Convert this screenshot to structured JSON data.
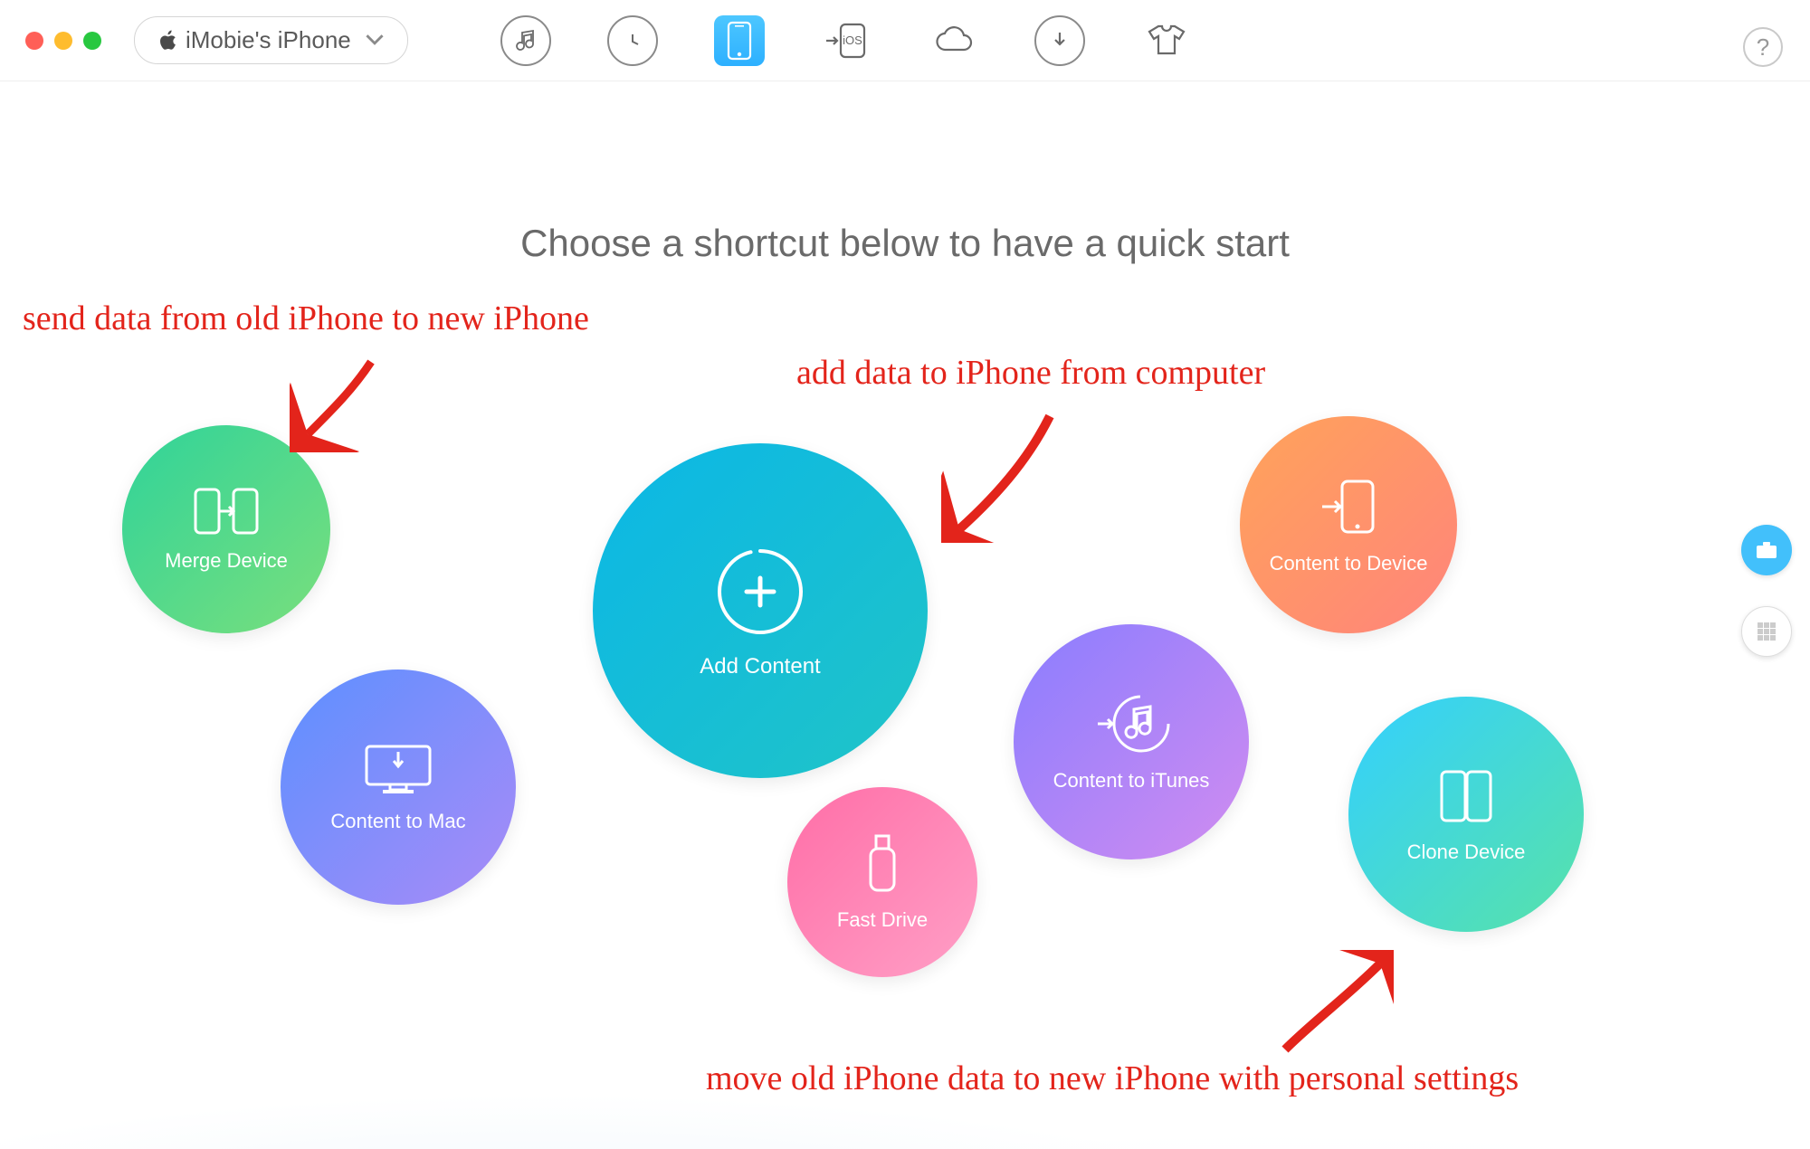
{
  "window": {
    "deviceLabel": "iMobie's iPhone"
  },
  "nav": {
    "items": [
      "music",
      "history",
      "device",
      "to-ios",
      "icloud",
      "download",
      "tshirt"
    ],
    "activeIndex": 2
  },
  "heading": "Choose a shortcut below to have a quick start",
  "bubbles": {
    "merge": {
      "label": "Merge Device"
    },
    "mac": {
      "label": "Content to Mac"
    },
    "add": {
      "label": "Add Content"
    },
    "fast": {
      "label": "Fast Drive"
    },
    "itunes": {
      "label": "Content to iTunes"
    },
    "c2d": {
      "label": "Content to Device"
    },
    "clone": {
      "label": "Clone Device"
    }
  },
  "annotations": {
    "a1": "send data from old iPhone to new iPhone",
    "a2": "add data to iPhone from computer",
    "a3": "move old iPhone data to new iPhone with personal settings"
  },
  "help": "?"
}
